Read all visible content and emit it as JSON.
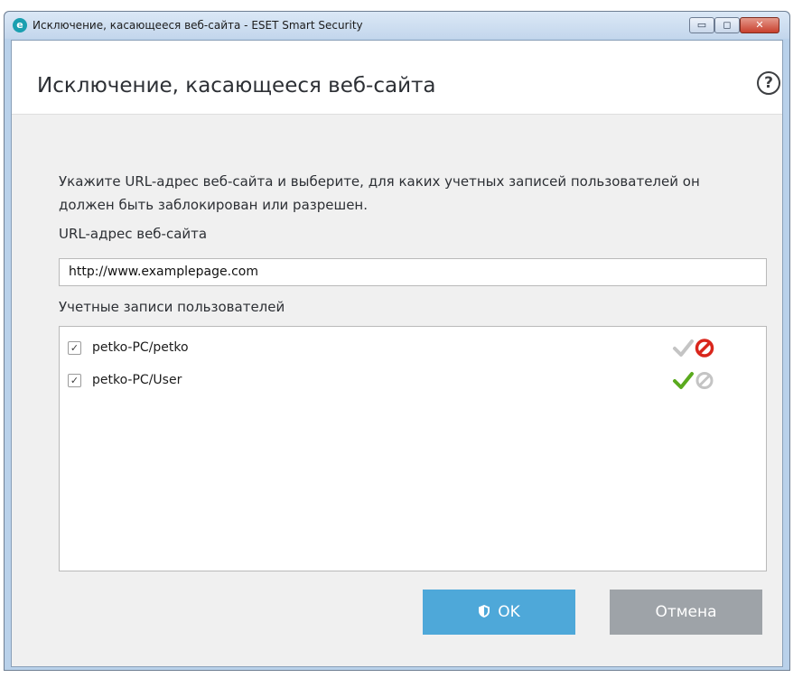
{
  "window": {
    "title": "Исключение, касающееся веб-сайта - ESET Smart Security",
    "logo_letter": "e",
    "controls": {
      "minimize": "▭",
      "maximize": "◻",
      "close": "✕"
    }
  },
  "header": {
    "title": "Исключение, касающееся веб-сайта",
    "help_symbol": "?"
  },
  "form": {
    "description": "Укажите URL-адрес веб-сайта и выберите, для каких учетных записей пользователей он должен быть заблокирован или разрешен.",
    "url_label": "URL-адрес веб-сайта",
    "url_value": "http://www.examplepage.com",
    "accounts_label": "Учетные записи пользователей",
    "accounts": [
      {
        "name": "petko-PC/petko",
        "checked": true,
        "checkmark": "✓",
        "status": "blocked",
        "status_icons": [
          "check-icon",
          "block-icon"
        ]
      },
      {
        "name": "petko-PC/User",
        "checked": true,
        "checkmark": "✓",
        "status": "allowed",
        "status_icons": [
          "check-icon",
          "block-icon"
        ]
      }
    ]
  },
  "buttons": {
    "ok_label": "OK",
    "cancel_label": "Отмена"
  },
  "colors": {
    "ok_button": "#4ea8d9",
    "cancel_button": "#9ea3a8",
    "allow_active": "#5aaa1e",
    "block_active": "#d9261c",
    "inactive": "#c4c4c4"
  }
}
